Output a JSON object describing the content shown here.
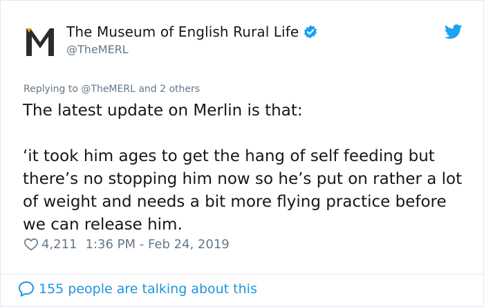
{
  "account": {
    "display_name": "The Museum of English Rural Life",
    "handle": "@TheMERL",
    "verified": true,
    "avatar_letter": "M"
  },
  "tweet": {
    "replying_prefix": "Replying to",
    "replying_to": "@TheMERL",
    "replying_suffix": "and 2 others",
    "text": "The latest update on Merlin is that:\n\n‘it took him ages to get the hang of self feeding but there’s no stopping him now so he’s put on rather a lot of weight and needs a bit more flying practice before we can release him.",
    "likes": "4,211",
    "timestamp": "1:36 PM - Feb 24, 2019"
  },
  "footer": {
    "conversation_label": "155 people are talking about this"
  },
  "colors": {
    "accent": "#1da1f2",
    "link": "#1b95e0",
    "muted": "#657786",
    "text": "#14171a",
    "border": "#e1e8ed",
    "logo_gold": "#e3a21a"
  },
  "icons": {
    "verified": "verified-badge-icon",
    "brand": "twitter-bird-icon",
    "like": "heart-icon",
    "conversation": "speech-bubble-icon"
  }
}
